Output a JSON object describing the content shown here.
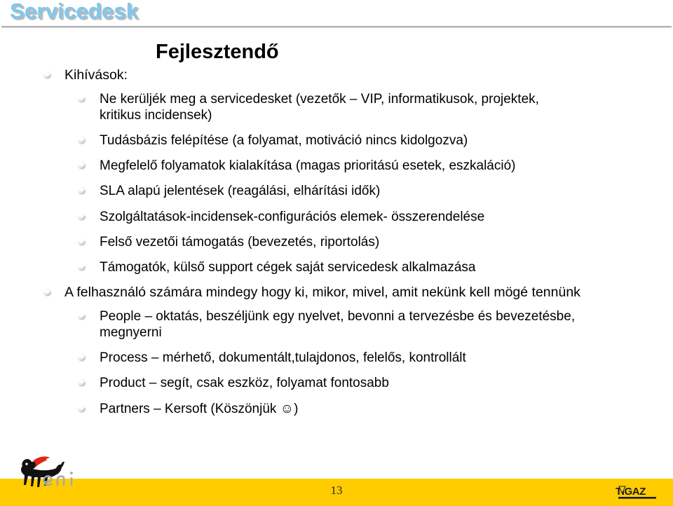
{
  "header": {
    "brand": "Servicedesk",
    "brand_color": "#7ec8ef"
  },
  "title": "Fejlesztendő",
  "bullets": [
    {
      "level": 1,
      "text": "Kihívások:"
    },
    {
      "level": 2,
      "text": "Ne kerüljék meg a servicedesket (vezetők – VIP, informatikusok, projektek, kritikus incidensek)"
    },
    {
      "level": 2,
      "text": "Tudásbázis felépítése (a folyamat, motiváció nincs kidolgozva)"
    },
    {
      "level": 2,
      "text": "Megfelelő folyamatok kialakítása (magas prioritású esetek, eszkaláció)"
    },
    {
      "level": 2,
      "text": "SLA alapú jelentések (reagálási, elhárítási idők)"
    },
    {
      "level": 2,
      "text": "Szolgáltatások-incidensek-configurációs elemek- összerendelése"
    },
    {
      "level": 2,
      "text": "Felső vezetői támogatás (bevezetés, riportolás)"
    },
    {
      "level": 2,
      "text": "Támogatók, külső support cégek saját servicedesk alkalmazása"
    },
    {
      "level": 1,
      "text": "A felhasználó számára mindegy hogy ki, mikor, mivel, amit nekünk kell mögé tennünk"
    },
    {
      "level": 2,
      "text": "People – oktatás, beszéljünk egy nyelvet, bevonni a tervezésbe és bevezetésbe, megnyerni"
    },
    {
      "level": 2,
      "text": "Process – mérhető, dokumentált,tulajdonos, felelős, kontrollált"
    },
    {
      "level": 2,
      "text": "Product – segít, csak eszköz, folyamat fontosabb"
    },
    {
      "level": 2,
      "text": "Partners – Kersoft  (Köszönjük ☺)"
    }
  ],
  "footer": {
    "page_number": "13",
    "band_color": "#ffcc00",
    "eni_logo_label": "eni",
    "tigaz_logo_label": "TIGAZ"
  }
}
